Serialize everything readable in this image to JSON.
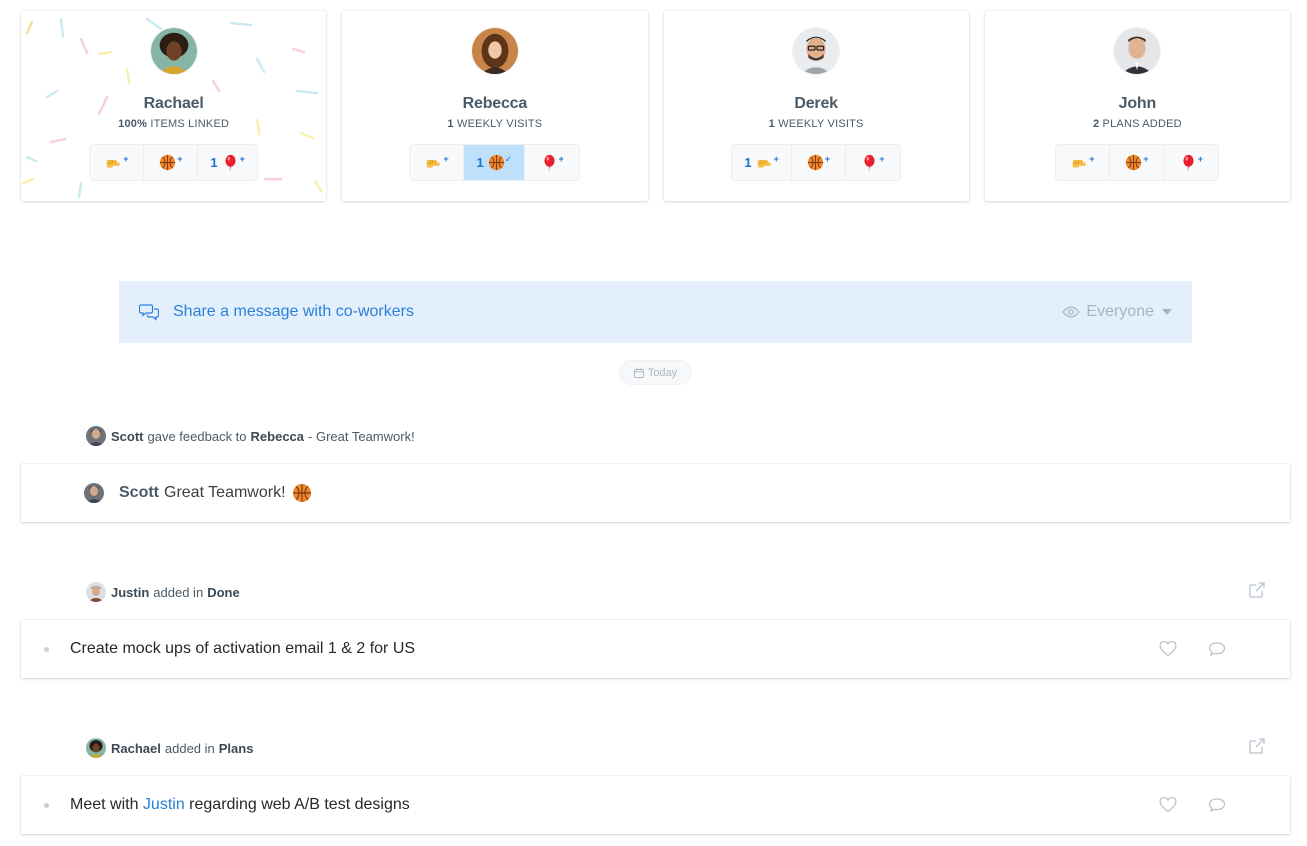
{
  "people": [
    {
      "name": "Rachael",
      "stat_bold": "100%",
      "stat_rest": " ITEMS LINKED",
      "reactions": [
        {
          "icon": "fist-bump-icon",
          "count": "",
          "state": "add"
        },
        {
          "icon": "basketball-icon",
          "count": "",
          "state": "add"
        },
        {
          "icon": "balloon-icon",
          "count": "1",
          "state": "add"
        }
      ]
    },
    {
      "name": "Rebecca",
      "stat_bold": "1",
      "stat_rest": " WEEKLY VISITS",
      "reactions": [
        {
          "icon": "fist-bump-icon",
          "count": "",
          "state": "add"
        },
        {
          "icon": "basketball-icon",
          "count": "1",
          "state": "given"
        },
        {
          "icon": "balloon-icon",
          "count": "",
          "state": "add"
        }
      ]
    },
    {
      "name": "Derek",
      "stat_bold": "1",
      "stat_rest": " WEEKLY VISITS",
      "reactions": [
        {
          "icon": "fist-bump-icon",
          "count": "1",
          "state": "add"
        },
        {
          "icon": "basketball-icon",
          "count": "",
          "state": "add"
        },
        {
          "icon": "balloon-icon",
          "count": "",
          "state": "add"
        }
      ]
    },
    {
      "name": "John",
      "stat_bold": "2",
      "stat_rest": " PLANS ADDED",
      "reactions": [
        {
          "icon": "fist-bump-icon",
          "count": "",
          "state": "add"
        },
        {
          "icon": "basketball-icon",
          "count": "",
          "state": "add"
        },
        {
          "icon": "balloon-icon",
          "count": "",
          "state": "add"
        }
      ]
    }
  ],
  "share": {
    "placeholder": "Share a message with co-workers",
    "audience": "Everyone"
  },
  "date_label": "Today",
  "feed": [
    {
      "type": "feedback",
      "author": "Scott",
      "action": "gave feedback to",
      "target": "Rebecca",
      "suffix": "- Great Teamwork!",
      "message": "Great Teamwork!"
    },
    {
      "type": "task",
      "author": "Justin",
      "action": "added in",
      "target": "Done",
      "text": "Create mock ups of activation email 1 & 2 for US"
    },
    {
      "type": "task",
      "author": "Rachael",
      "action": "added in",
      "target": "Plans",
      "text_before": "Meet with ",
      "mention": "Justin",
      "text_after": " regarding web A/B test designs"
    }
  ],
  "colors": {
    "accent": "#2a7fd9",
    "share_bg": "#e3f0fc",
    "active_reaction": "#bfe0fb",
    "muted": "#a8b5c1"
  }
}
